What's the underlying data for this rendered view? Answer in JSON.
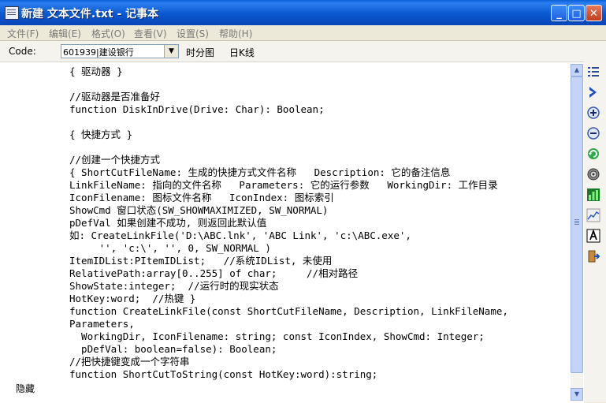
{
  "window": {
    "title": "新建 文本文件.txt - 记事本",
    "buttons": {
      "minimize": "_",
      "maximize": "□",
      "close": "✕"
    }
  },
  "menu": [
    "文件(F)",
    "编辑(E)",
    "格式(O)",
    "查看(V)",
    "设置(S)",
    "帮助(H)"
  ],
  "toolbar": {
    "code_label": "Code:",
    "stock_value": "601939|建设银行",
    "link_time": "时分图",
    "link_kline": "日K线"
  },
  "sidebar_label": "隐藏",
  "sidebar_icons": [
    "list-icon",
    "arrow-right-icon",
    "zoom-in-icon",
    "zoom-out-icon",
    "refresh-icon",
    "target-icon",
    "bar-chart-icon",
    "line-chart-icon",
    "font-icon",
    "exit-icon"
  ],
  "colors": {
    "title_bar": "#0a58d0",
    "close_button": "#c33c1a",
    "background": "#ece9d8"
  },
  "editor": {
    "lines": [
      "{ 驱动器 }",
      "",
      "//驱动器是否准备好",
      "function DiskInDrive(Drive: Char): Boolean;",
      "",
      "{ 快捷方式 }",
      "",
      "//创建一个快捷方式",
      "{ ShortCutFileName: 生成的快捷方式文件名称   Description: 它的备注信息",
      "LinkFileName: 指向的文件名称   Parameters: 它的运行参数   WorkingDir: 工作目录",
      "IconFilename: 图标文件名称   IconIndex: 图标索引",
      "ShowCmd 窗口状态(SW_SHOWMAXIMIZED, SW_NORMAL)",
      "pDefVal 如果创建不成功, 则返回此默认值",
      "如: CreateLinkFile('D:\\ABC.lnk', 'ABC Link', 'c:\\ABC.exe',",
      "     '', 'c:\\', '', 0, SW_NORMAL )",
      "ItemIDList:PItemIDList;   //系统IDList, 未使用",
      "RelativePath:array[0..255] of char;     //相对路径",
      "ShowState:integer;  //运行时的现实状态",
      "HotKey:word;  //热键 }",
      "function CreateLinkFile(const ShortCutFileName, Description, LinkFileName,",
      "Parameters,",
      "  WorkingDir, IconFilename: string; const IconIndex, ShowCmd: Integer;",
      "  pDefVal: boolean=false): Boolean;",
      "//把快捷键变成一个字符串",
      "function ShortCutToString(const HotKey:word):string;"
    ]
  }
}
